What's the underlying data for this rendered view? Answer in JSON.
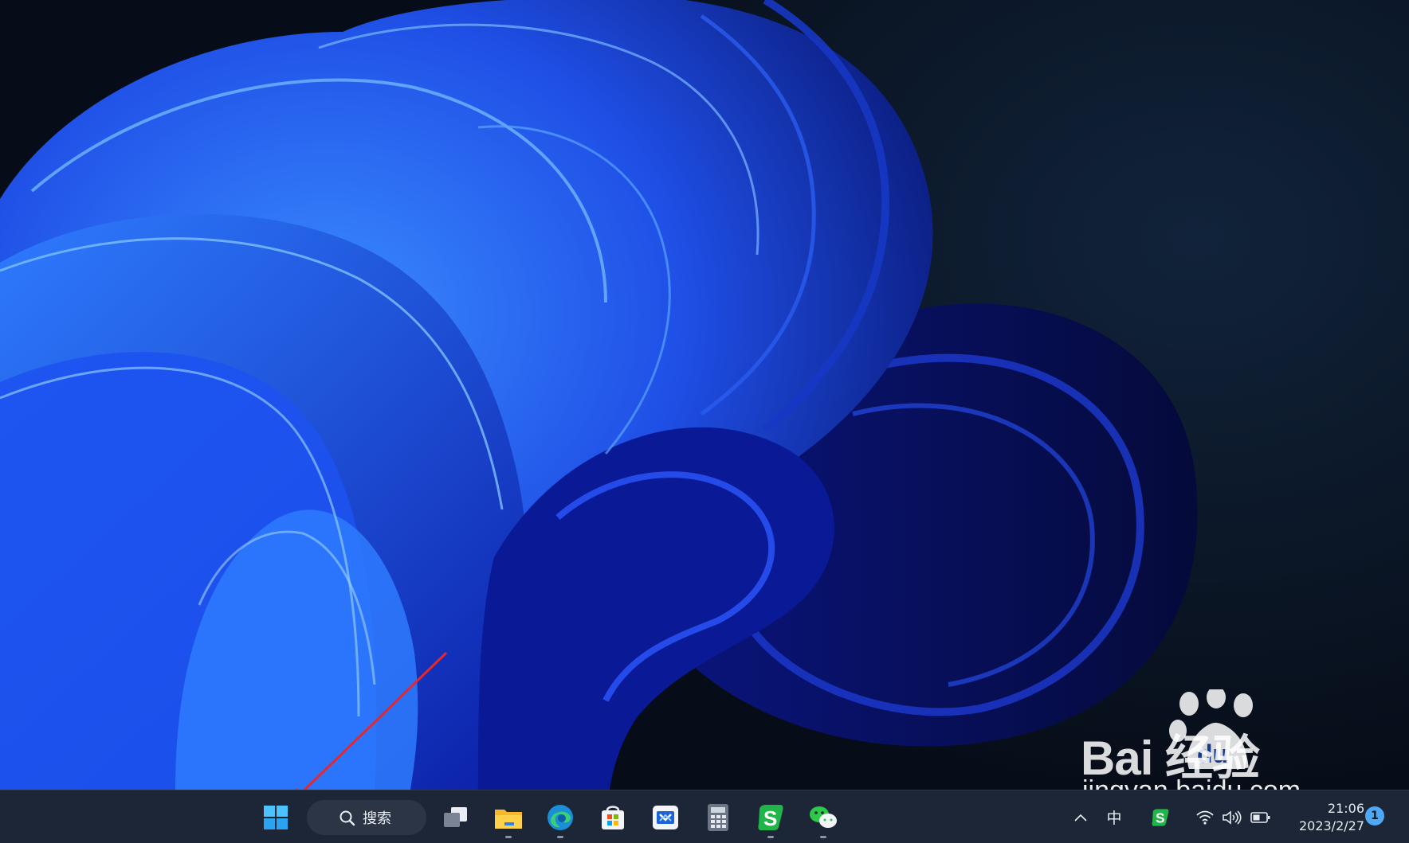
{
  "desktop": {
    "wallpaper": "windows-11-bloom-blue",
    "annotation": "red-arrow-pointing-to-start-button"
  },
  "watermark": {
    "brand": "Bai  经验",
    "paw_text": "du",
    "url": "jingyan.baidu.com"
  },
  "taskbar": {
    "start_icon": "windows-logo-icon",
    "search_label": "搜索",
    "apps": [
      {
        "name": "task-view",
        "icon": "task-view-icon",
        "running": false
      },
      {
        "name": "file-explorer",
        "icon": "folder-icon",
        "running": true
      },
      {
        "name": "edge",
        "icon": "edge-icon",
        "running": true
      },
      {
        "name": "microsoft-store",
        "icon": "store-icon",
        "running": false
      },
      {
        "name": "remote-app",
        "icon": "remote-icon",
        "running": false
      },
      {
        "name": "calculator",
        "icon": "calculator-icon",
        "running": false
      },
      {
        "name": "sogou-input",
        "icon": "sogou-icon",
        "running": true
      },
      {
        "name": "wechat",
        "icon": "wechat-icon",
        "running": true
      }
    ],
    "tray": {
      "chevron": "^",
      "ime": "中",
      "time": "21:06",
      "date": "2023/2/27",
      "notifications": "1"
    }
  },
  "colors": {
    "taskbar_bg": "#1c2636",
    "accent": "#4ea8f5",
    "arrow": "#e8262b"
  }
}
